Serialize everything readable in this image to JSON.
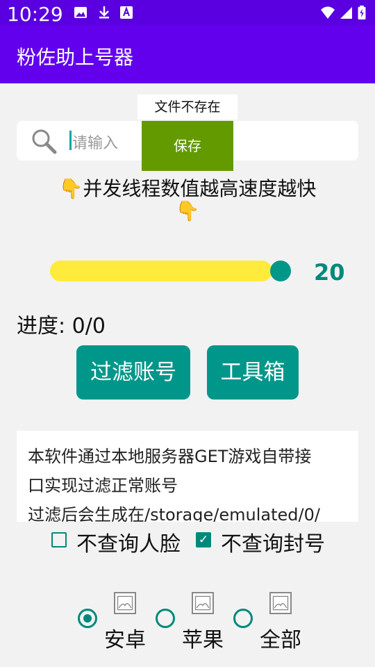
{
  "status_bar": {
    "time": "10:29",
    "icons": [
      "image-icon",
      "download-icon",
      "a-box-icon",
      "wifi-icon",
      "signal-icon",
      "battery-icon"
    ]
  },
  "app_bar": {
    "title": "粉佐助上号器"
  },
  "toast": {
    "text": "文件不存在"
  },
  "search": {
    "placeholder": "请输入"
  },
  "save_button": {
    "label": "保存"
  },
  "hint": {
    "line1": "👇并发线程数值越高速度越快",
    "line2": "👇"
  },
  "slider": {
    "value": "20"
  },
  "progress": {
    "text": "进度: 0/0"
  },
  "buttons": {
    "filter": "过滤账号",
    "toolbox": "工具箱"
  },
  "description": {
    "lines": [
      "本软件通过本地服务器GET游戏自带接",
      "口实现过滤正常账号",
      "过滤后会生成在/storage/emulated/0/"
    ]
  },
  "checkboxes": [
    {
      "label": "不查询人脸",
      "checked": false
    },
    {
      "label": "不查询封号",
      "checked": true
    }
  ],
  "radios": [
    {
      "label": "安卓",
      "selected": true
    },
    {
      "label": "苹果",
      "selected": false
    },
    {
      "label": "全部",
      "selected": false
    }
  ],
  "colors": {
    "status_bar": "#5a00e0",
    "app_bar": "#6200ee",
    "accent": "#00978a",
    "slider_track": "#ffeb3b",
    "save_button": "#639a00"
  }
}
